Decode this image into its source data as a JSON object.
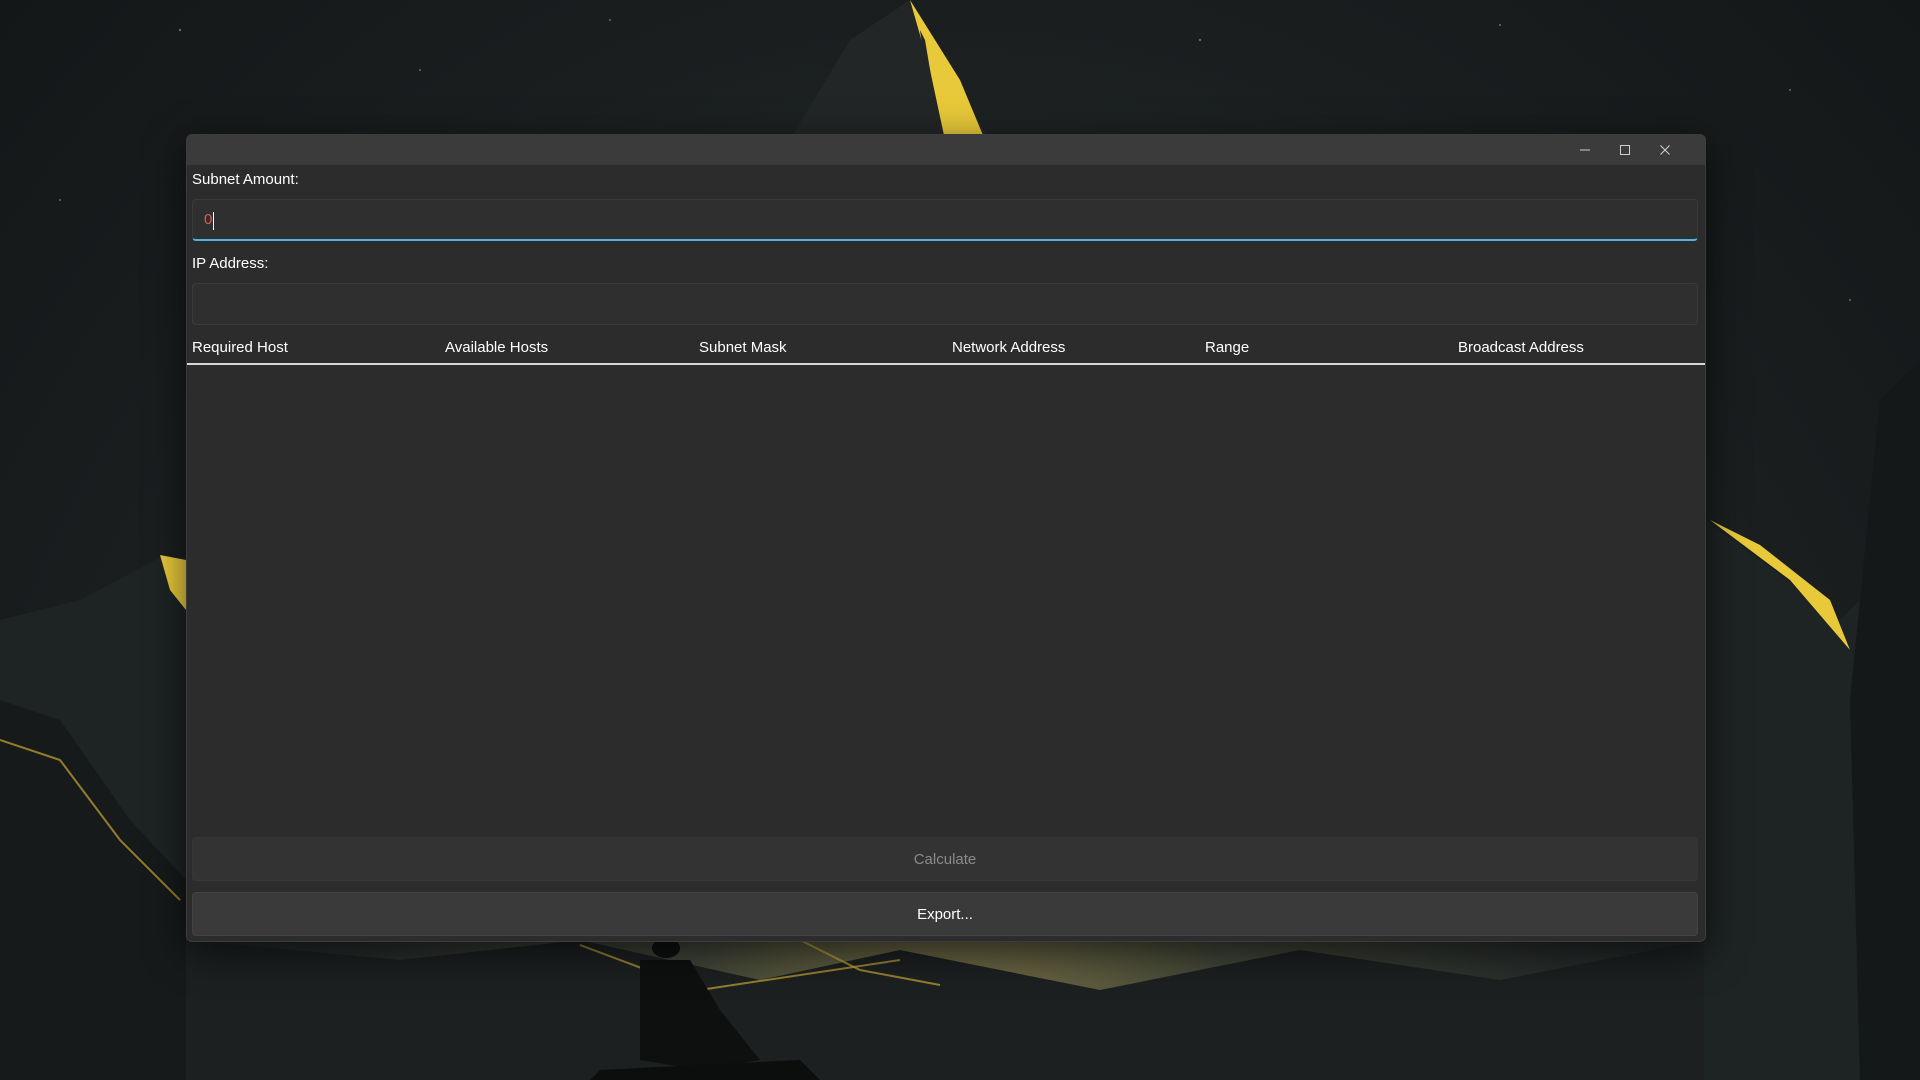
{
  "window": {
    "title": "",
    "caption_buttons": {
      "minimize_icon": "minimize-icon",
      "maximize_icon": "maximize-icon",
      "close_icon": "close-icon"
    }
  },
  "form": {
    "subnet_amount": {
      "label": "Subnet Amount:",
      "value": "0"
    },
    "ip_address": {
      "label": "IP Address:",
      "value": ""
    }
  },
  "table": {
    "columns": [
      "Required Host",
      "Available Hosts",
      "Subnet Mask",
      "Network Address",
      "Range",
      "Broadcast Address"
    ],
    "rows": []
  },
  "buttons": {
    "calculate": {
      "label": "Calculate",
      "enabled": false
    },
    "export": {
      "label": "Export...",
      "enabled": true
    }
  },
  "colors": {
    "accent": "#4cb4e8",
    "window_bg": "#2c2c2c",
    "titlebar_bg": "#3b3b3b",
    "input_text": "#e05a4f",
    "wallpaper_accent": "#e8c93a"
  }
}
